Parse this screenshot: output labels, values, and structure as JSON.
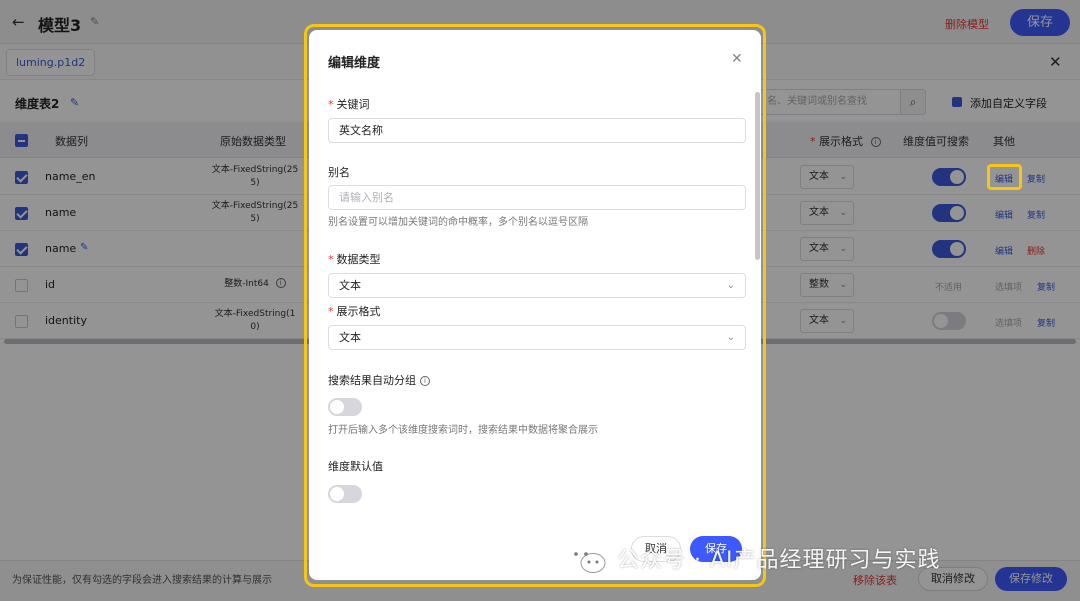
{
  "header": {
    "title": "模型3",
    "delete_model": "删除模型",
    "save": "保存"
  },
  "tabs": {
    "file_tab": "luming.p1d2"
  },
  "dimension": {
    "title": "维度表2",
    "search_placeholder": "名、关键词或别名查找",
    "add_field": "添加自定义字段"
  },
  "table": {
    "headers": {
      "column": "数据列",
      "raw_type": "原始数据类型",
      "format": "展示格式",
      "searchable": "维度值可搜索",
      "other": "其他"
    },
    "rows": [
      {
        "name": "name_en",
        "type_line1": "文本-FixedString(25",
        "type_line2": "5)",
        "format": "文本",
        "searchable": true,
        "checked": true,
        "op1": "编辑",
        "op2": "复制"
      },
      {
        "name": "name",
        "type_line1": "文本-FixedString(25",
        "type_line2": "5)",
        "format": "文本",
        "searchable": true,
        "checked": true,
        "op1": "编辑",
        "op2": "复制"
      },
      {
        "name": "name",
        "type_line1": "",
        "type_line2": "",
        "format": "文本",
        "searchable": true,
        "checked": true,
        "op1": "编辑",
        "op2": "删除"
      },
      {
        "name": "id",
        "type_line1": "整数-Int64",
        "type_line2": "",
        "format": "整数",
        "searchable": null,
        "na_text": "不适用",
        "checked": false,
        "op1": "选填项",
        "op2": "复制"
      },
      {
        "name": "identity",
        "type_line1": "文本-FixedString(1",
        "type_line2": "0)",
        "format": "文本",
        "searchable": false,
        "checked": false,
        "op1": "选填项",
        "op2": "复制"
      }
    ]
  },
  "footer": {
    "note": "为保证性能，仅有勾选的字段会进入搜索结果的计算与展示",
    "remove_table": "移除该表",
    "cancel_edit": "取消修改",
    "save_edit": "保存修改"
  },
  "modal": {
    "title": "编辑维度",
    "keyword_label": "关键词",
    "keyword_value": "英文名称",
    "alias_label": "别名",
    "alias_placeholder": "请输入别名",
    "alias_hint": "别名设置可以增加关键词的命中概率，多个别名以逗号区隔",
    "data_type_label": "数据类型",
    "data_type_value": "文本",
    "display_format_label": "展示格式",
    "display_format_value": "文本",
    "auto_group_label": "搜索结果自动分组",
    "auto_group_hint": "打开后输入多个该维度搜索词时，搜索结果中数据将聚合展示",
    "default_value_label": "维度默认值",
    "cancel": "取消",
    "save": "保存"
  },
  "watermark": {
    "text": "公众号 · AI产品经理研习与实践"
  },
  "colors": {
    "primary": "#3d5afe",
    "danger": "#e53935",
    "highlight": "#f5c518"
  }
}
